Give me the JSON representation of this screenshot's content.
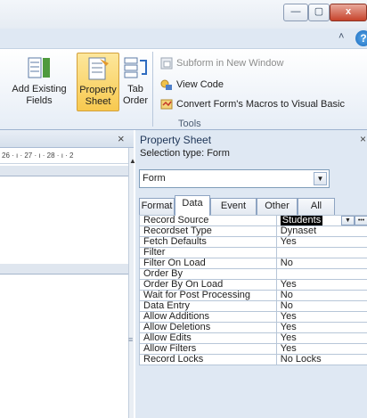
{
  "window_buttons": {
    "minimize": "—",
    "restore": "▢",
    "close": "x"
  },
  "ribbon": {
    "add_existing_fields": "Add Existing Fields",
    "property_sheet": "Property Sheet",
    "tab_order": "Tab Order",
    "subform_in_new_window": "Subform in New Window",
    "view_code": "View Code",
    "convert_macros": "Convert Form's Macros to Visual Basic",
    "group_tools": "Tools"
  },
  "ruler_text": "26 · ı · 27 · ı · 28 · ı · 2",
  "property_sheet": {
    "title": "Property Sheet",
    "selection_type": "Selection type:  Form",
    "selected_object": "Form",
    "tabs": [
      "Format",
      "Data",
      "Event",
      "Other",
      "All"
    ],
    "active_tab": "Data",
    "properties": [
      {
        "name": "Record Source",
        "value": "Students"
      },
      {
        "name": "Recordset Type",
        "value": "Dynaset"
      },
      {
        "name": "Fetch Defaults",
        "value": "Yes"
      },
      {
        "name": "Filter",
        "value": ""
      },
      {
        "name": "Filter On Load",
        "value": "No"
      },
      {
        "name": "Order By",
        "value": ""
      },
      {
        "name": "Order By On Load",
        "value": "Yes"
      },
      {
        "name": "Wait for Post Processing",
        "value": "No"
      },
      {
        "name": "Data Entry",
        "value": "No"
      },
      {
        "name": "Allow Additions",
        "value": "Yes"
      },
      {
        "name": "Allow Deletions",
        "value": "Yes"
      },
      {
        "name": "Allow Edits",
        "value": "Yes"
      },
      {
        "name": "Allow Filters",
        "value": "Yes"
      },
      {
        "name": "Record Locks",
        "value": "No Locks"
      }
    ]
  }
}
